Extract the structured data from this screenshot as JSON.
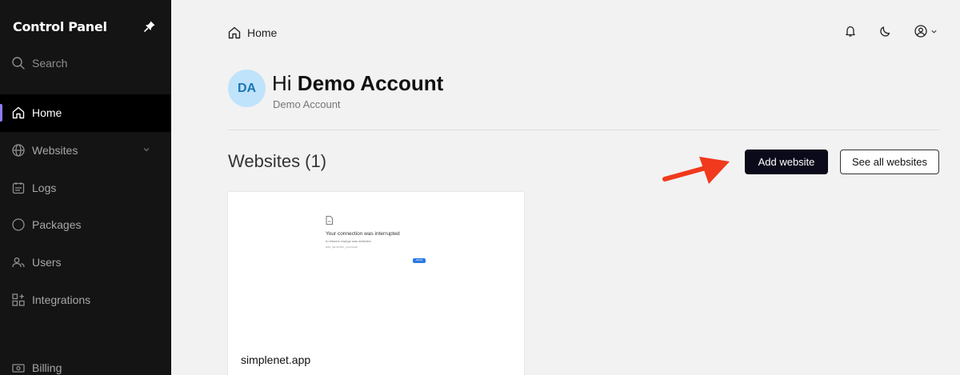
{
  "sidebar": {
    "title": "Control Panel",
    "search_label": "Search",
    "items": [
      {
        "label": "Home",
        "icon": "home-icon",
        "active": true
      },
      {
        "label": "Websites",
        "icon": "globe-icon",
        "has_submenu": true
      },
      {
        "label": "Logs",
        "icon": "calendar-list-icon"
      },
      {
        "label": "Packages",
        "icon": "circle-icon"
      },
      {
        "label": "Users",
        "icon": "users-icon"
      },
      {
        "label": "Integrations",
        "icon": "grid-plus-icon"
      }
    ],
    "billing_label": "Billing",
    "accent_color": "#8b7cf6"
  },
  "header": {
    "breadcrumb": "Home"
  },
  "greeting": {
    "avatar_initials": "DA",
    "hi": "Hi",
    "name": "Demo Account",
    "subtitle": "Demo Account"
  },
  "websites": {
    "title": "Websites (1)",
    "add_button": "Add website",
    "see_all_button": "See all websites",
    "cards": [
      {
        "name": "simplenet.app",
        "preview": {
          "title": "Your connection was interrupted",
          "subtitle": "A network change was detected.",
          "code": "ERR_NETWORK_CHANGED",
          "button": "Reload"
        }
      }
    ]
  },
  "colors": {
    "sidebar_bg": "#141414",
    "primary_button": "#0a0a1a",
    "avatar_bg": "#bfe3fb",
    "annotation_arrow": "#f0391d"
  }
}
